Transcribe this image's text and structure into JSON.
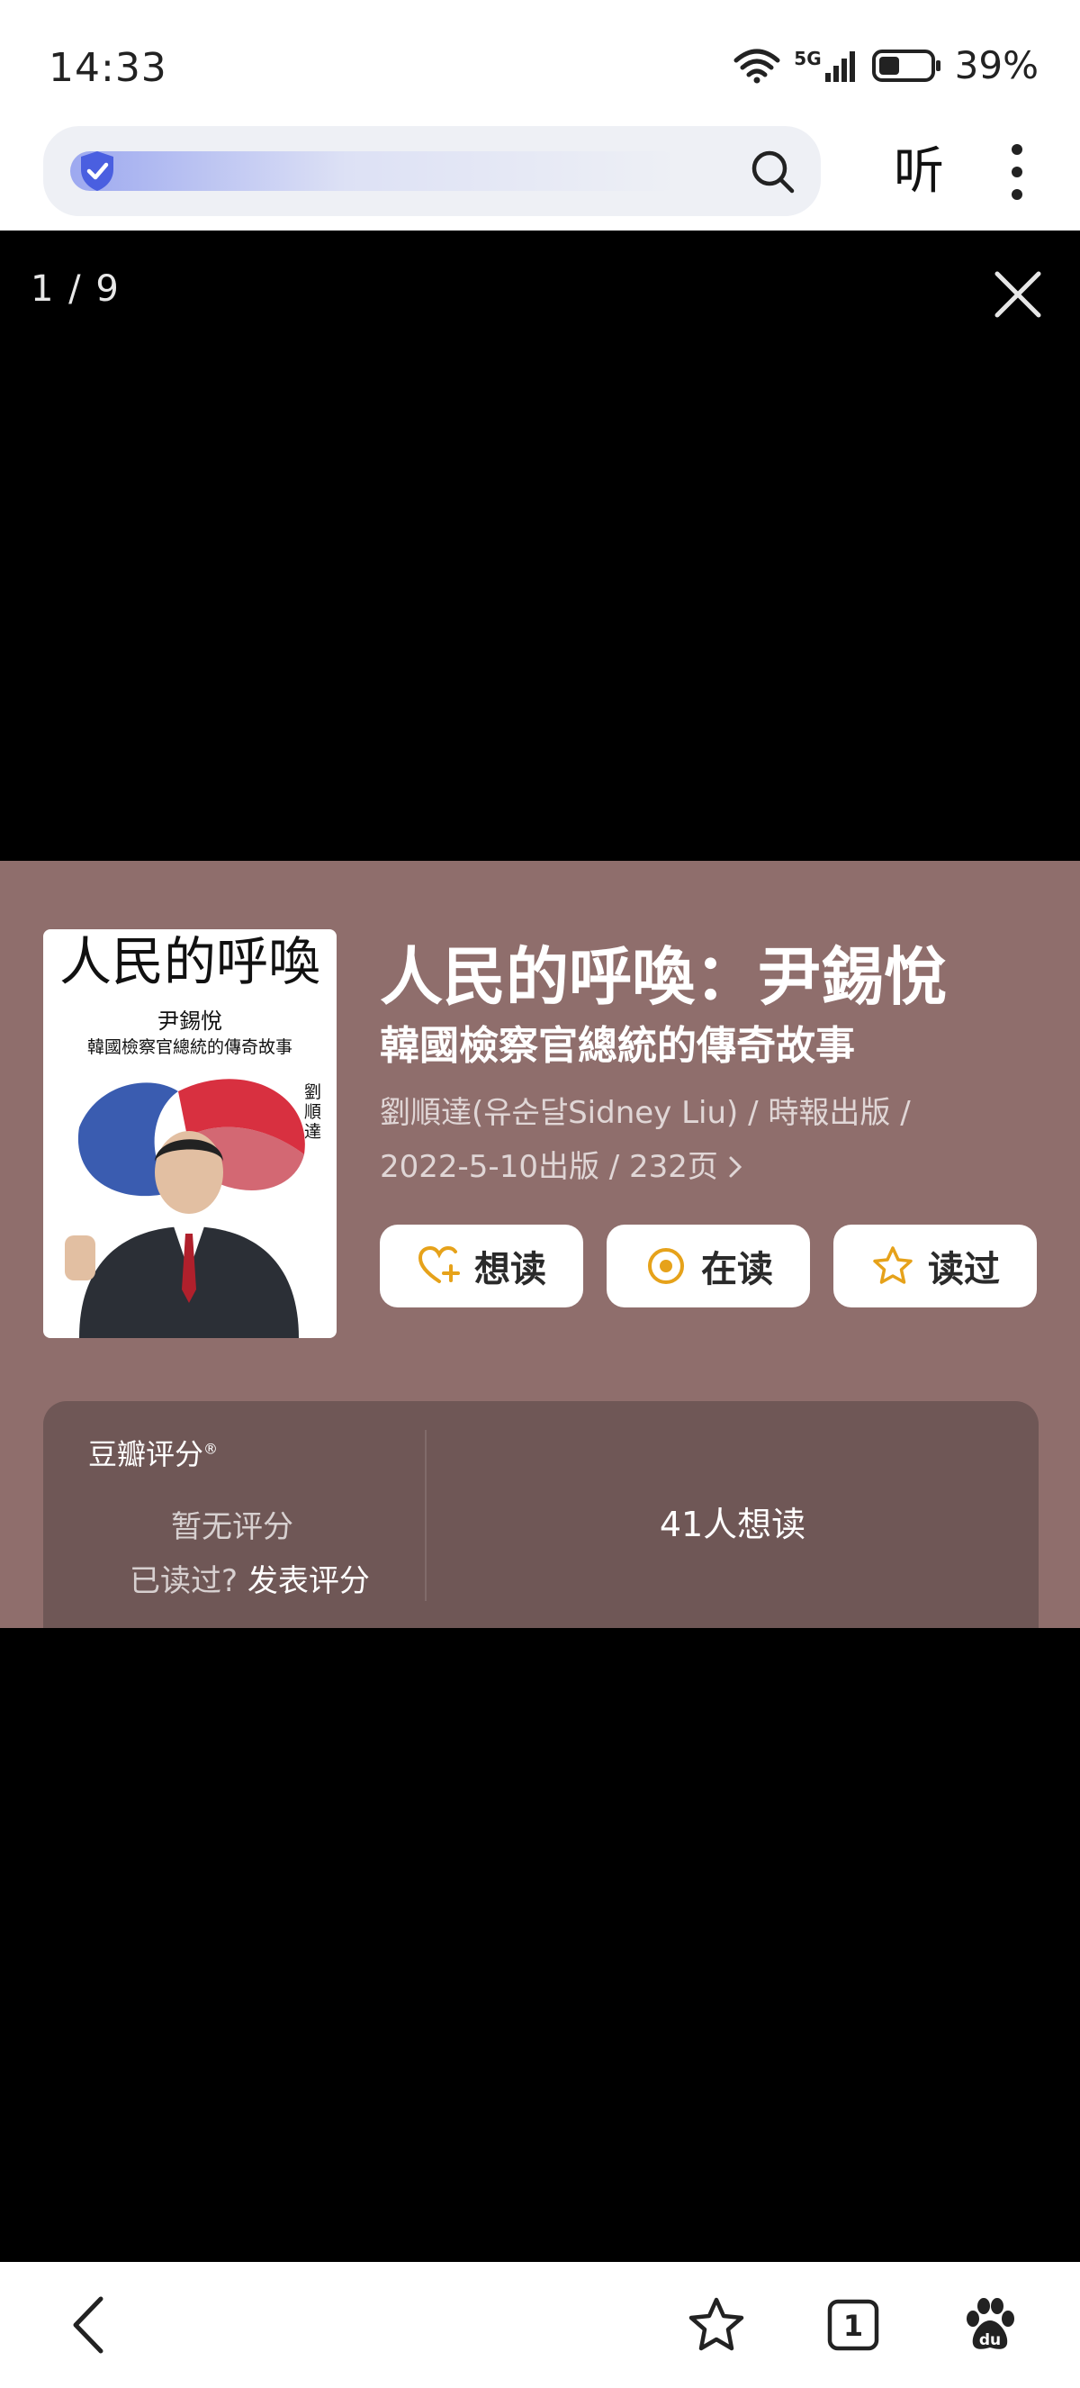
{
  "status": {
    "time": "14:33",
    "network": "5G",
    "battery": "39%",
    "battery_level": 0.39
  },
  "browser": {
    "listen_label": "听"
  },
  "viewer": {
    "counter": "1 / 9"
  },
  "cover": {
    "title": "人民的呼喚",
    "subtitle": "尹錫悅",
    "tagline": "韓國檢察官總統的傳奇故事",
    "author": "劉順達"
  },
  "book": {
    "title": "人民的呼喚：尹錫悅",
    "subtitle": "韓國檢察官總統的傳奇故事",
    "meta_line1": "劉順達(유순달Sidney Liu) / 時報出版 /",
    "meta_line2": "2022-5-10出版 / 232页",
    "actions": [
      {
        "label": "想读",
        "icon": "heart-plus-icon"
      },
      {
        "label": "在读",
        "icon": "target-icon"
      },
      {
        "label": "读过",
        "icon": "star-icon"
      }
    ]
  },
  "rating": {
    "title": "豆瓣评分",
    "no_rating": "暂无评分",
    "read_prompt": "已读过?",
    "publish_link": "发表评分",
    "want_count": "41人想读"
  },
  "colors": {
    "card_bg": "#8f6e6c",
    "panel_bg": "#6f5756",
    "accent": "#e6a21a"
  }
}
